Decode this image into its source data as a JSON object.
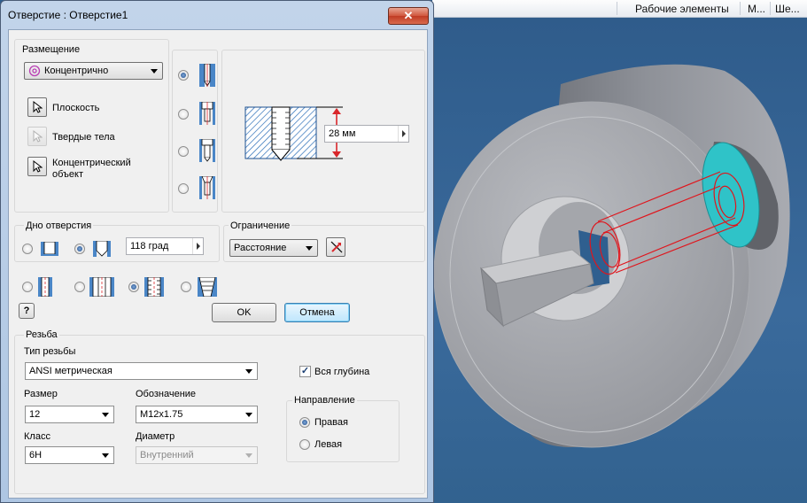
{
  "window": {
    "title": "Отверстие : Отверстие1",
    "close_glyph": "✕"
  },
  "topbar": {
    "item1": "Рабочие элементы",
    "item2": "М...",
    "item3": "Ше..."
  },
  "placement": {
    "label": "Размещение",
    "mode": "Концентрично",
    "plane_label": "Плоскость",
    "solids_label": "Твердые тела",
    "concentric_line1": "Концентрический",
    "concentric_line2": "объект"
  },
  "preview": {
    "depth_value": "28 мм"
  },
  "bottom": {
    "label": "Дно отверстия",
    "angle": "118 град"
  },
  "termination": {
    "label": "Ограничение",
    "value": "Расстояние"
  },
  "buttons": {
    "help_glyph": "?",
    "ok": "OK",
    "cancel": "Отмена"
  },
  "thread": {
    "label": "Резьба",
    "type_label": "Тип резьбы",
    "type_value": "ANSI метрическая",
    "full_depth_label": "Вся глубина",
    "full_depth_checked": true,
    "size_label": "Размер",
    "size_value": "12",
    "designation_label": "Обозначение",
    "designation_value": "M12x1.75",
    "class_label": "Класс",
    "class_value": "6H",
    "diameter_label": "Диаметр",
    "diameter_value": "Внутренний",
    "direction_label": "Направление",
    "right_label": "Правая",
    "left_label": "Левая"
  },
  "colors": {
    "accent_red": "#d9262a",
    "hatch_blue": "#2c6fb8",
    "face_cyan": "#2fc3c8"
  }
}
